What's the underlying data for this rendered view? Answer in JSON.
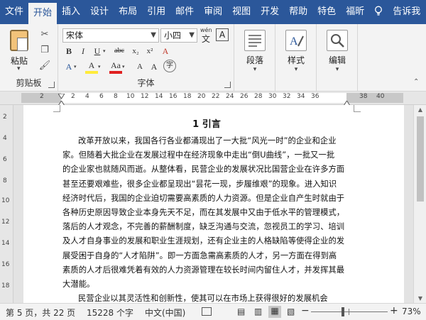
{
  "tabs": [
    "文件",
    "开始",
    "插入",
    "设计",
    "布局",
    "引用",
    "邮件",
    "审阅",
    "视图",
    "开发",
    "帮助",
    "特色",
    "福昕"
  ],
  "active_tab": "开始",
  "tell_me": "告诉我",
  "ribbon": {
    "clipboard": {
      "paste_label": "粘贴",
      "group_label": "剪贴板"
    },
    "font": {
      "font_name": "宋体",
      "font_size": "小四",
      "wen_label": "wén",
      "buttons": [
        "B",
        "I",
        "U",
        "abc",
        "x₂",
        "x²",
        "A",
        "A",
        "A",
        "Aa",
        "A",
        "A",
        "字"
      ],
      "group_label": "字体"
    },
    "paragraph": {
      "label": "段落"
    },
    "styles": {
      "label": "样式"
    },
    "editing": {
      "label": "编辑"
    }
  },
  "ruler": {
    "numbers": [
      "2",
      "2",
      "4",
      "6",
      "8",
      "10",
      "12",
      "14",
      "16",
      "18",
      "20",
      "22",
      "24",
      "26",
      "28",
      "30",
      "32",
      "34",
      "36",
      "38",
      "40"
    ]
  },
  "vruler": {
    "numbers": [
      "2",
      "4",
      "6",
      "8",
      "10",
      "12",
      "14",
      "16",
      "18"
    ]
  },
  "document": {
    "heading": "1  引言",
    "lines": [
      "改革开放以来，我国各行各业都涌现出了一大批“风光一时”的企业和企业",
      "家。但随着大批企业在发展过程中在经济现象中走出“倒U曲线”，一批又一批",
      "的企业家也就随风而逝。从整体看，民营企业的发展状况比国营企业在许多方面",
      "甚至还要艰难些，很多企业都呈现出“昙花一现，步履维艰”的现象。进入知识",
      "经济时代后，我国的企业迫切需要高素质的人力资源。但是企业自产生时就由于",
      "各种历史原因导致企业本身先天不足，而在其发展中又由于低水平的管理模式，",
      "落后的人才观念，不完善的薪酬制度，缺乏沟通与交流，忽视员工的学习、培训",
      "及人才自身事业的发展和职业生涯规划，还有企业主的人格缺陷等使得企业的发",
      "展受困于自身的“人才陷阱”。即一方面急需高素质的人才，另一方面在得到高",
      "素质的人才后很难凭着有效的人力资源管理在较长时间内留住人才，并发挥其最",
      "大潜能。",
      "民营企业以其灵活性和创新性，使其可以在市场上获得很好的发展机会"
    ]
  },
  "status": {
    "page": "第 5 页，共 22 页",
    "words": "15228 个字",
    "language": "中文(中国)",
    "zoom_minus": "−",
    "zoom_plus": "+",
    "zoom": "73%"
  }
}
